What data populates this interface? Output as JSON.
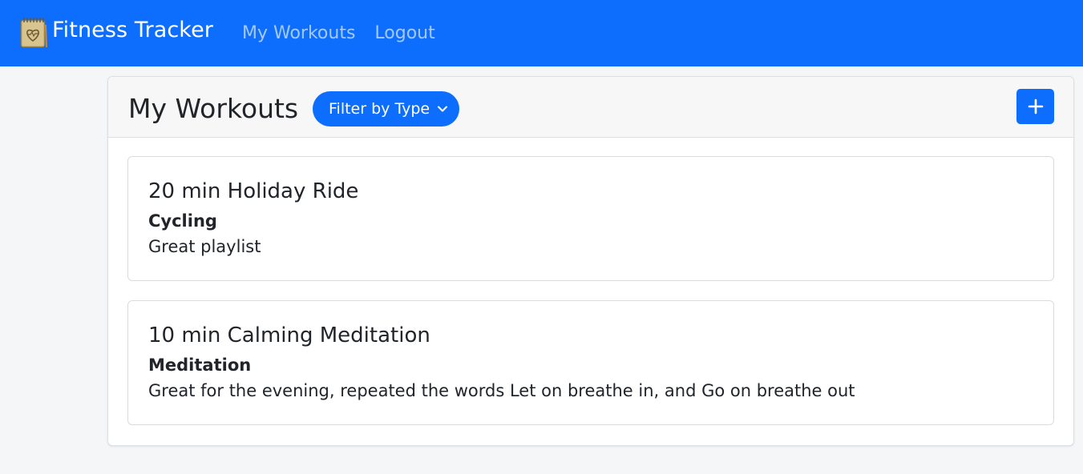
{
  "navbar": {
    "brand": "Fitness Tracker",
    "brand_icon": "notebook-heart-icon",
    "links": [
      "My Workouts",
      "Logout"
    ]
  },
  "main": {
    "title": "My Workouts",
    "filter": {
      "label": "Filter by Type",
      "icon": "chevron-down-icon"
    },
    "add_button": {
      "icon": "plus-icon"
    },
    "workouts": [
      {
        "title": "20 min Holiday Ride",
        "type": "Cycling",
        "notes": "Great playlist"
      },
      {
        "title": "10 min Calming Meditation",
        "type": "Meditation",
        "notes": "Great for the evening, repeated the words Let on breathe in, and Go on breathe out"
      }
    ]
  },
  "colors": {
    "primary": "#0d6efd",
    "background": "#f5f6f8",
    "header_bg": "#f7f7f7"
  }
}
